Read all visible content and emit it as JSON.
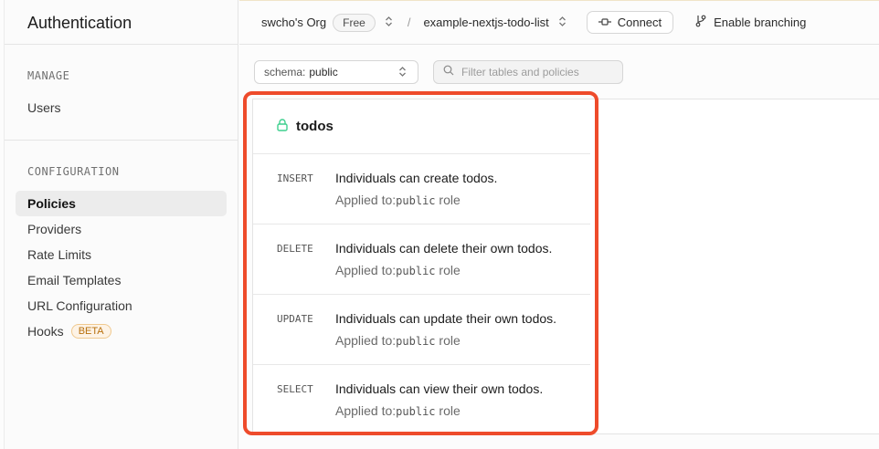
{
  "sidebar": {
    "title": "Authentication",
    "manage_heading": "MANAGE",
    "manage_items": [
      {
        "label": "Users"
      }
    ],
    "config_heading": "CONFIGURATION",
    "config_items": [
      {
        "label": "Policies",
        "active": true
      },
      {
        "label": "Providers"
      },
      {
        "label": "Rate Limits"
      },
      {
        "label": "Email Templates"
      },
      {
        "label": "URL Configuration"
      },
      {
        "label": "Hooks",
        "badge": "BETA"
      }
    ]
  },
  "topbar": {
    "org": "swcho's Org",
    "plan": "Free",
    "separator": "/",
    "project": "example-nextjs-todo-list",
    "connect_label": "Connect",
    "branching_label": "Enable branching"
  },
  "filters": {
    "schema_label": "schema:",
    "schema_value": "public",
    "search_placeholder": "Filter tables and policies",
    "search_value": ""
  },
  "table": {
    "name": "todos",
    "policies": [
      {
        "command": "INSERT",
        "name": "Individuals can create todos.",
        "applied_prefix": "Applied to:",
        "role": "public",
        "role_suffix": " role"
      },
      {
        "command": "DELETE",
        "name": "Individuals can delete their own todos.",
        "applied_prefix": "Applied to:",
        "role": "public",
        "role_suffix": " role"
      },
      {
        "command": "UPDATE",
        "name": "Individuals can update their own todos.",
        "applied_prefix": "Applied to:",
        "role": "public",
        "role_suffix": " role"
      },
      {
        "command": "SELECT",
        "name": "Individuals can view their own todos.",
        "applied_prefix": "Applied to:",
        "role": "public",
        "role_suffix": " role"
      }
    ]
  },
  "colors": {
    "highlight": "#ee4b2b",
    "lock_icon": "#3ecf8e",
    "beta_badge": "#b8700e"
  }
}
